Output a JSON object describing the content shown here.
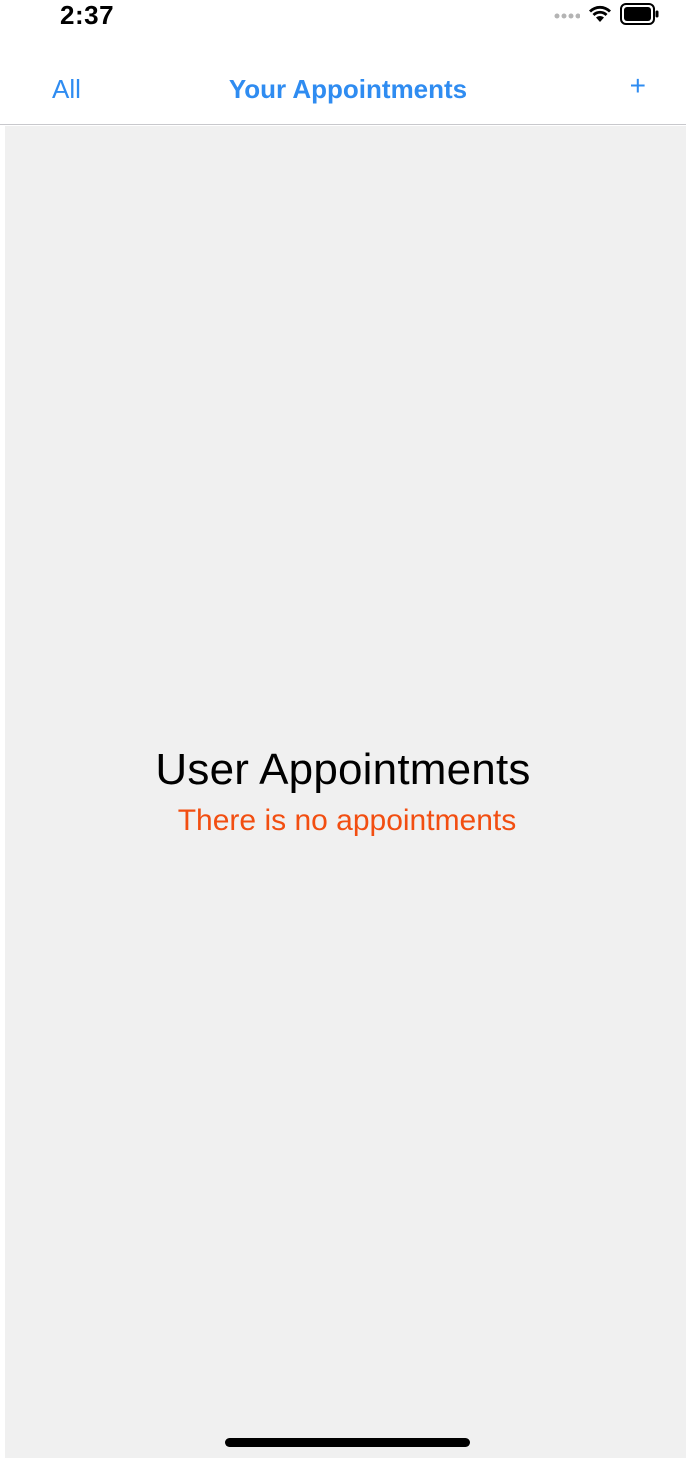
{
  "status_bar": {
    "time": "2:37"
  },
  "nav": {
    "left_label": "All",
    "title": "Your Appointments",
    "right_label": "+"
  },
  "empty_state": {
    "title": "User Appointments",
    "subtitle": "There is no appointments"
  },
  "colors": {
    "accent": "#2f8cf1",
    "warning": "#f24e11",
    "background": "#f0f0f0"
  },
  "icons": [
    "signal-dots-icon",
    "wifi-icon",
    "battery-icon"
  ]
}
